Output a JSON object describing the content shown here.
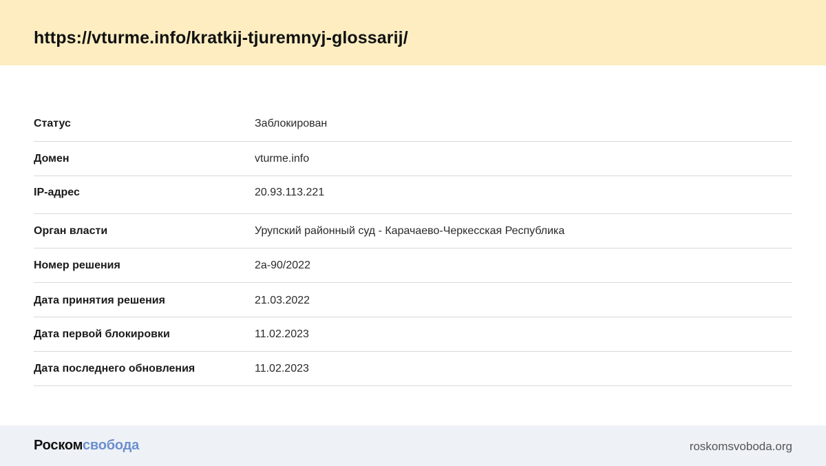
{
  "header": {
    "url": "https://vturme.info/kratkij-tjuremnyj-glossarij/"
  },
  "rows": [
    {
      "label": "Статус",
      "value": "Заблокирован"
    },
    {
      "label": "Домен",
      "value": "vturme.info"
    },
    {
      "label": "IP-адрес",
      "value": "20.93.113.221"
    },
    {
      "label": "Орган власти",
      "value": "Урупский районный суд - Карачаево-Черкесская Республика"
    },
    {
      "label": "Номер решения",
      "value": "2а-90/2022"
    },
    {
      "label": "Дата принятия решения",
      "value": "21.03.2022"
    },
    {
      "label": "Дата первой блокировки",
      "value": "11.02.2023"
    },
    {
      "label": "Дата последнего обновления",
      "value": "11.02.2023"
    }
  ],
  "footer": {
    "logo_part1": "Роском",
    "logo_part2": "свобода",
    "site": "roskomsvoboda.org"
  },
  "colors": {
    "header_bg": "#fdedc1",
    "footer_bg": "#eef2f7",
    "logo_accent": "#6d8fcf"
  }
}
